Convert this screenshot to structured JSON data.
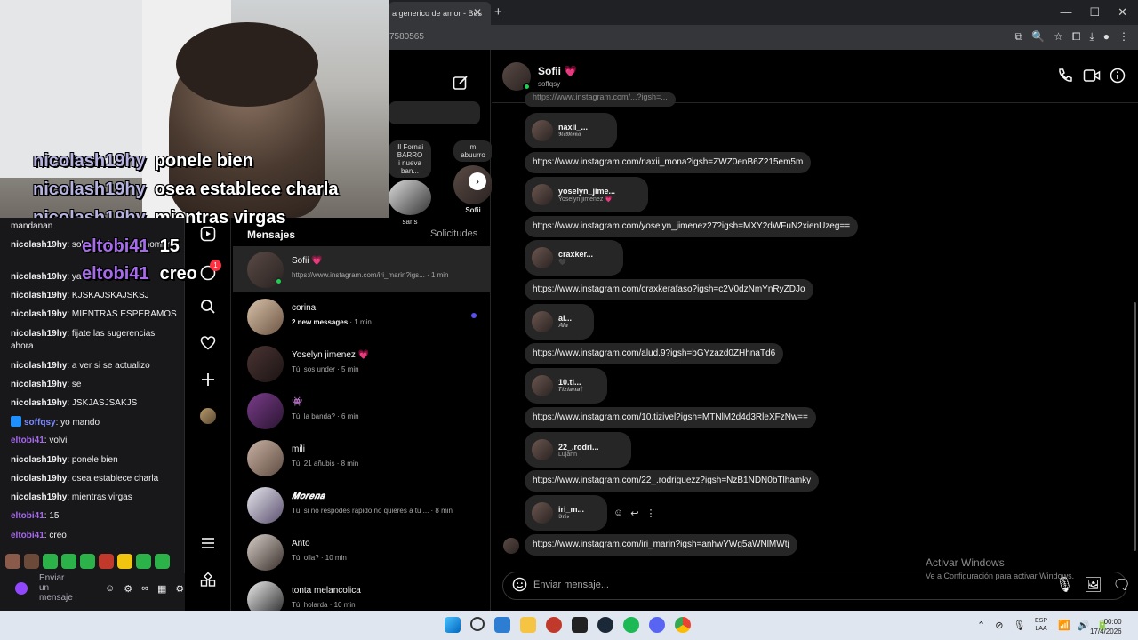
{
  "browser": {
    "tab_title": "a generico de amor - Bus",
    "tab_close": "✕",
    "new_tab": "+",
    "address": "7580565",
    "window_controls": [
      "—",
      "☐",
      "✕"
    ],
    "address_icons": [
      "⧉",
      "🔍",
      "☆",
      "⧠",
      "⤓",
      "●",
      "⋮"
    ]
  },
  "ig_nav": {
    "icons": [
      "reels-icon",
      "notifications-icon",
      "search-icon",
      "heart-icon",
      "create-icon",
      "profile-icon",
      "menu-icon",
      "apps-icon"
    ],
    "badge": "1"
  },
  "conv_list": {
    "messages_label": "Mensajes",
    "requests_label": "Solicitudes",
    "notes": [
      {
        "text": "lll Fornai\nBARRO\ni nueva ban...",
        "name": "sans"
      },
      {
        "text": "m abuurro",
        "name": "Sofii"
      }
    ],
    "items": [
      {
        "name": "Sofii 💗",
        "sub": "https://www.instagram.com/iri_marin?igs...",
        "time": "1 min",
        "online": true,
        "unread": false
      },
      {
        "name": "corina",
        "sub": "2 new messages",
        "time": "1 min",
        "online": false,
        "unread": true
      },
      {
        "name": "Yoselyn jimenez 💗",
        "sub": "Tú: sos under",
        "time": "5 min",
        "online": false,
        "unread": false
      },
      {
        "name": "👾",
        "sub": "Tú: la banda?",
        "time": "6 min",
        "online": false,
        "unread": false
      },
      {
        "name": "mili",
        "sub": "Tú: 21 añubis",
        "time": "8 min",
        "online": false,
        "unread": false
      },
      {
        "name": "𝑴𝒐𝒓𝒆𝒏𝒂",
        "sub": "Tú: si no respodes rapido no quieres a tu ...",
        "time": "8 min",
        "online": false,
        "unread": false
      },
      {
        "name": "Anto",
        "sub": "Tú: olla?",
        "time": "10 min",
        "online": false,
        "unread": false
      },
      {
        "name": "tonta melancolica",
        "sub": "Tú: holarda",
        "time": "10 min",
        "online": false,
        "unread": false
      }
    ]
  },
  "chat": {
    "name": "Sofii 💗",
    "handle": "soffqsy",
    "header_icons": [
      "☏",
      "▭",
      "ⓘ"
    ],
    "top_partial": "https://www.instagram.com/...?igsh=...",
    "messages": [
      {
        "card_user": "naxii_...",
        "card_sub": "𝕹𝖆𝕸𝖔𝖓𝖆",
        "link": "https://www.instagram.com/naxii_mona?igsh=ZWZ0enB6Z215em5m"
      },
      {
        "card_user": "yoselyn_jime...",
        "card_sub": "Yoselyn jimenez 💗",
        "link": "https://www.instagram.com/yoselyn_jimenez27?igsh=MXY2dWFuN2xienUzeg=="
      },
      {
        "card_user": "craxker...",
        "card_sub": "🖤",
        "link": "https://www.instagram.com/craxkerafaso?igsh=c2V0dzNmYnRyZDJo"
      },
      {
        "card_user": "al...",
        "card_sub": "𝑨𝒍𝒂",
        "link": "https://www.instagram.com/alud.9?igsh=bGYzazd0ZHhnaTd6"
      },
      {
        "card_user": "10.ti...",
        "card_sub": "𝑻𝒊𝒛𝒊𝒂𝒏𝒂†",
        "link": "https://www.instagram.com/10.tizivel?igsh=MTNlM2d4d3RleXFzNw=="
      },
      {
        "card_user": "22_.rodri...",
        "card_sub": "Lujânn",
        "link": "https://www.instagram.com/22_.rodriguezz?igsh=NzB1NDN0bTlhamky"
      },
      {
        "card_user": "iri_m...",
        "card_sub": "𝕴𝖗𝖎𝖘",
        "link": "https://www.instagram.com/iri_marin?igsh=anhwYWg5aWNlMWtj"
      }
    ],
    "msg_actions": [
      "☺",
      "↩",
      "⋮"
    ],
    "composer_placeholder": "Enviar mensaje...",
    "composer_icons": [
      "🎙",
      "🖼",
      "🗨"
    ]
  },
  "watermark": {
    "title": "Activar Windows",
    "subtitle": "Ve a Configuración para activar Windows."
  },
  "stream_overlay": {
    "lines": [
      {
        "user": "nicolash19hy",
        "text": "ponele bien"
      },
      {
        "user": "nicolash19hy",
        "text": "osea establece charla"
      },
      {
        "user": "nicolash19hy",
        "text": "mientras virgas"
      },
      {
        "user": "eltobi41",
        "text": "15"
      },
      {
        "user": "eltobi41",
        "text": "creo"
      }
    ]
  },
  "twitch_chat": {
    "messages": [
      {
        "user": "",
        "text": "mandanan",
        "color": "#efeff1"
      },
      {
        "user": "nicolash19hy",
        "text": "solo que habla un hombre",
        "color": "#efeff1"
      },
      {
        "user": "nicolash19hy",
        "text": "ya",
        "color": "#efeff1"
      },
      {
        "user": "nicolash19hy",
        "text": "KJSKAJSKAJSKSJ",
        "color": "#efeff1"
      },
      {
        "user": "nicolash19hy",
        "text": "MIENTRAS ESPERAMOS",
        "color": "#efeff1"
      },
      {
        "user": "nicolash19hy",
        "text": "fijate las sugerencias ahora",
        "color": "#efeff1"
      },
      {
        "user": "nicolash19hy",
        "text": "a ver si se actualizo",
        "color": "#efeff1"
      },
      {
        "user": "nicolash19hy",
        "text": "se",
        "color": "#efeff1"
      },
      {
        "user": "nicolash19hy",
        "text": "JSKJASJSAKJS",
        "color": "#efeff1"
      },
      {
        "user": "soffqsy",
        "text": "yo mando",
        "color": "#7c8cff"
      },
      {
        "user": "eltobi41",
        "text": "volvi",
        "color": "#a56bea"
      },
      {
        "user": "nicolash19hy",
        "text": "ponele bien",
        "color": "#efeff1"
      },
      {
        "user": "nicolash19hy",
        "text": "osea establece charla",
        "color": "#efeff1"
      },
      {
        "user": "nicolash19hy",
        "text": "mientras virgas",
        "color": "#efeff1"
      },
      {
        "user": "eltobi41",
        "text": "15",
        "color": "#a56bea"
      },
      {
        "user": "eltobi41",
        "text": "creo",
        "color": "#a56bea"
      }
    ],
    "send_label": "Enviar un mensaje",
    "input_icons": [
      "☺",
      "⚙",
      "∞",
      "▦",
      "⚙"
    ]
  },
  "taskbar": {
    "tray": [
      "⌃",
      "⊘",
      "🎙",
      "📶",
      "🔊",
      "🔋"
    ],
    "lang_top": "ESP",
    "lang_bottom": "LAA",
    "time": "00:00",
    "date": "17/4/2026"
  }
}
